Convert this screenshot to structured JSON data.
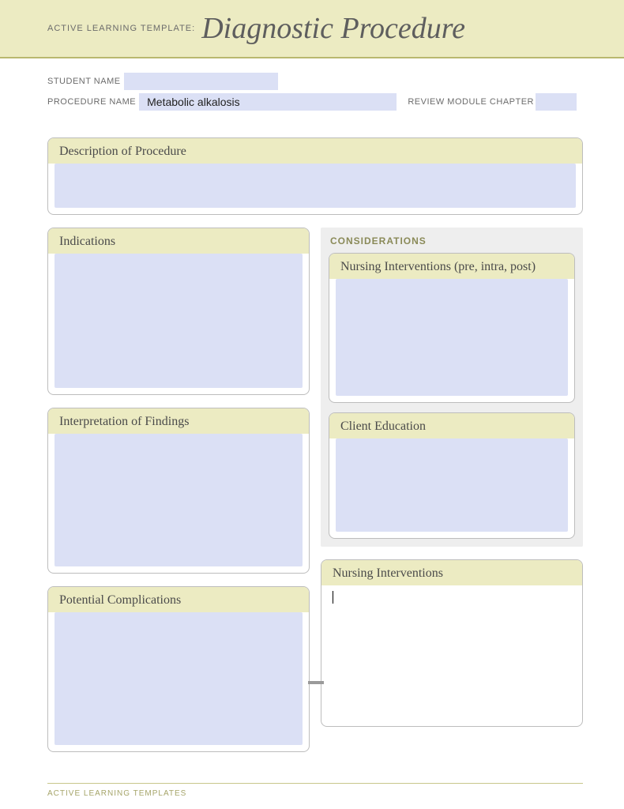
{
  "header": {
    "template_prefix": "ACTIVE LEARNING TEMPLATE:",
    "title": "Diagnostic Procedure"
  },
  "meta": {
    "student_label": "STUDENT NAME",
    "student_value": "",
    "procedure_label": "PROCEDURE NAME",
    "procedure_value": "Metabolic alkalosis",
    "chapter_label": "REVIEW MODULE CHAPTER",
    "chapter_value": ""
  },
  "boxes": {
    "description": {
      "title": "Description of Procedure",
      "content": ""
    },
    "indications": {
      "title": "Indications",
      "content": ""
    },
    "interpretation": {
      "title": "Interpretation of Findings",
      "content": ""
    },
    "potential_complications": {
      "title": "Potential Complications",
      "content": ""
    },
    "considerations_label": "CONSIDERATIONS",
    "nursing_pre": {
      "title": "Nursing Interventions (pre, intra, post)",
      "content": ""
    },
    "client_education": {
      "title": "Client Education",
      "content": ""
    },
    "nursing_interventions": {
      "title": "Nursing Interventions",
      "content": ""
    }
  },
  "footer": {
    "text": "ACTIVE LEARNING TEMPLATES"
  }
}
